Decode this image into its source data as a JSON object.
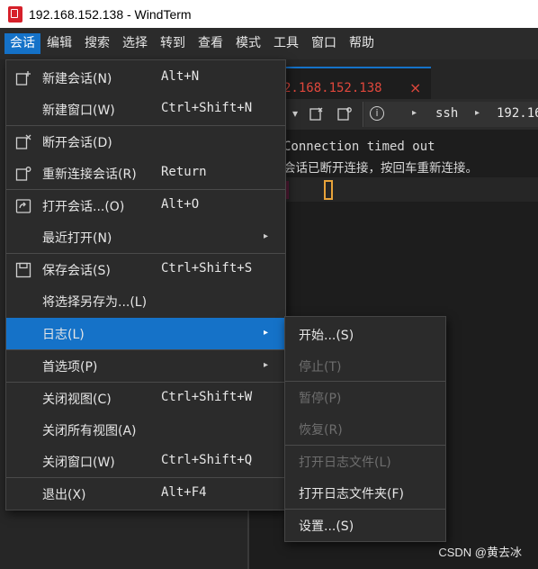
{
  "window": {
    "title": "192.168.152.138 - WindTerm"
  },
  "menubar": [
    "会话",
    "编辑",
    "搜索",
    "选择",
    "转到",
    "查看",
    "模式",
    "工具",
    "窗口",
    "帮助"
  ],
  "session_tab": {
    "title": "2.168.152.138",
    "close": "×"
  },
  "toolbar": {
    "chevron": "▾",
    "proto": "ssh",
    "host": "192.16",
    "arrow": "▸"
  },
  "terminal": {
    "line1": "Connection timed out",
    "line2": "会话已断开连接，按回车重新连接。"
  },
  "session_menu": {
    "new_session": {
      "label": "新建会话(N)",
      "shortcut": "Alt+N"
    },
    "new_window": {
      "label": "新建窗口(W)",
      "shortcut": "Ctrl+Shift+N"
    },
    "disconnect": {
      "label": "断开会话(D)",
      "shortcut": ""
    },
    "reconnect": {
      "label": "重新连接会话(R)",
      "shortcut": "Return"
    },
    "open_session": {
      "label": "打开会话...(O)",
      "shortcut": "Alt+O"
    },
    "recent": {
      "label": "最近打开(N)",
      "shortcut": ""
    },
    "save_session": {
      "label": "保存会话(S)",
      "shortcut": "Ctrl+Shift+S"
    },
    "save_selection": {
      "label": "将选择另存为...(L)",
      "shortcut": ""
    },
    "log": {
      "label": "日志(L)",
      "shortcut": ""
    },
    "preferences": {
      "label": "首选项(P)",
      "shortcut": ""
    },
    "close_view": {
      "label": "关闭视图(C)",
      "shortcut": "Ctrl+Shift+W"
    },
    "close_all_views": {
      "label": "关闭所有视图(A)",
      "shortcut": ""
    },
    "close_window": {
      "label": "关闭窗口(W)",
      "shortcut": "Ctrl+Shift+Q"
    },
    "exit": {
      "label": "退出(X)",
      "shortcut": "Alt+F4"
    }
  },
  "log_submenu": {
    "start": "开始...(S)",
    "stop": "停止(T)",
    "pause": "暂停(P)",
    "resume": "恢复(R)",
    "open_log_file": "打开日志文件(L)",
    "open_log_folder": "打开日志文件夹(F)",
    "settings": "设置...(S)"
  },
  "submenu_arrow": "▸",
  "watermark": "CSDN @黄去冰",
  "colors": {
    "accent": "#1572c8",
    "brand": "#d6202a",
    "tab_text": "#e0473c",
    "cursor": "#e8a33a"
  }
}
